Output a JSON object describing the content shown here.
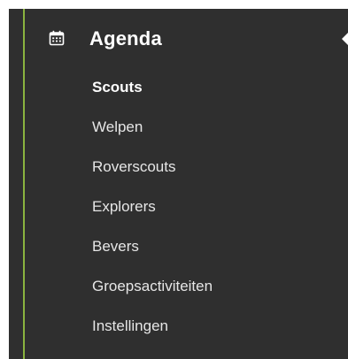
{
  "colors": {
    "background": "#2f2f2f",
    "accent": "#8ab33f",
    "text": "#e6e6e6",
    "text_active": "#ffffff"
  },
  "section": {
    "icon": "calendar-icon",
    "title": "Agenda"
  },
  "menu": {
    "active_index": 0,
    "items": [
      {
        "label": "Scouts"
      },
      {
        "label": "Welpen"
      },
      {
        "label": "Roverscouts"
      },
      {
        "label": "Explorers"
      },
      {
        "label": "Bevers"
      },
      {
        "label": "Groepsactiviteiten"
      },
      {
        "label": "Instellingen"
      }
    ]
  }
}
